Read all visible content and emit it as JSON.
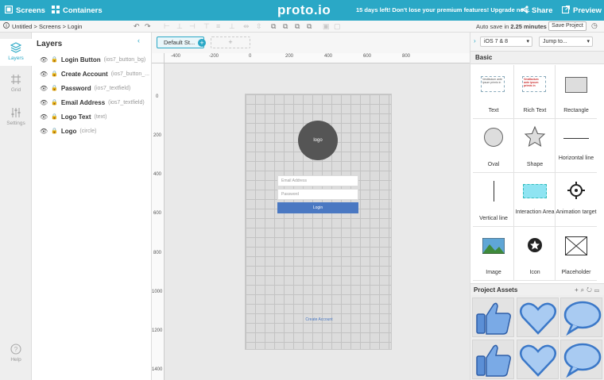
{
  "topbar": {
    "screens_label": "Screens",
    "containers_label": "Containers",
    "brand": "proto.io",
    "promo_text": "15 days left! Don't lose your premium features! Upgrade now.",
    "share_label": "Share",
    "preview_label": "Preview",
    "bg_color": "#2aa8c6"
  },
  "breadcrumb": {
    "path": "Untitled > Screens > Login",
    "autosave_prefix": "Auto save in",
    "autosave_value": "2.25 minutes",
    "save_label": "Save Project"
  },
  "rail": {
    "layers": "Layers",
    "grid": "Grid",
    "settings": "Settings",
    "help": "Help"
  },
  "layers_panel": {
    "title": "Layers",
    "items": [
      {
        "name": "Login Button",
        "type": "(ios7_button_bg)"
      },
      {
        "name": "Create Account",
        "type": "(ios7_button_..."
      },
      {
        "name": "Password",
        "type": "(ios7_textfield)"
      },
      {
        "name": "Email Address",
        "type": "(ios7_textfield)"
      },
      {
        "name": "Logo Text",
        "type": "(text)"
      },
      {
        "name": "Logo",
        "type": "(circle)"
      }
    ]
  },
  "canvas": {
    "state_label": "Default St...",
    "ruler_x": [
      "-400",
      "-200",
      "0",
      "200",
      "400",
      "600",
      "800"
    ],
    "ruler_y": [
      "0",
      "200",
      "400",
      "600",
      "800",
      "1000",
      "1200",
      "1400"
    ],
    "logo_text": "logo",
    "email_placeholder": "Email Address",
    "password_placeholder": "Password",
    "login_label": "Login",
    "create_account_label": "Create Account"
  },
  "right_panel": {
    "device_select": "iOS 7 & 8",
    "jump_select": "Jump to...",
    "basic_title": "Basic",
    "widgets": [
      {
        "label": "Text"
      },
      {
        "label": "Rich Text"
      },
      {
        "label": "Rectangle"
      },
      {
        "label": "Oval"
      },
      {
        "label": "Shape"
      },
      {
        "label": "Horizontal line"
      },
      {
        "label": "Vertical line"
      },
      {
        "label": "Interaction Area"
      },
      {
        "label": "Animation target"
      },
      {
        "label": "Image"
      },
      {
        "label": "Icon"
      },
      {
        "label": "Placeholder"
      }
    ],
    "text_widget_preview": "Vestibulum ante ipsum primis in",
    "richtext_widget_preview": "Vestibulum ante ipsum primis in",
    "assets_title": "Project Assets"
  }
}
